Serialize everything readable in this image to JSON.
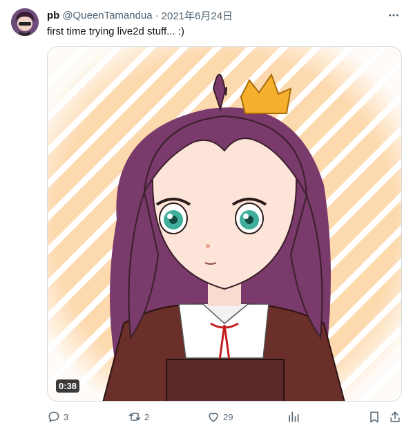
{
  "tweet": {
    "display_name": "pb",
    "handle": "@QueenTamandua",
    "separator": "·",
    "date": "2021年6月24日",
    "text": "first time trying live2d stuff... :)",
    "more_icon": "ellipsis-icon",
    "media": {
      "type": "video",
      "duration": "0:38",
      "background_color": "#fdd9ae",
      "stripe_color": "#ffffff",
      "hair_color": "#7a3a6b",
      "eye_color": "#3fae9b",
      "jacket_color": "#6b2f2a",
      "crown_color": "#f6b02e"
    },
    "actions": {
      "reply_count": "3",
      "retweet_count": "2",
      "like_count": "29",
      "views_icon": "analytics-icon",
      "bookmark_icon": "bookmark-icon",
      "share_icon": "share-icon"
    }
  }
}
